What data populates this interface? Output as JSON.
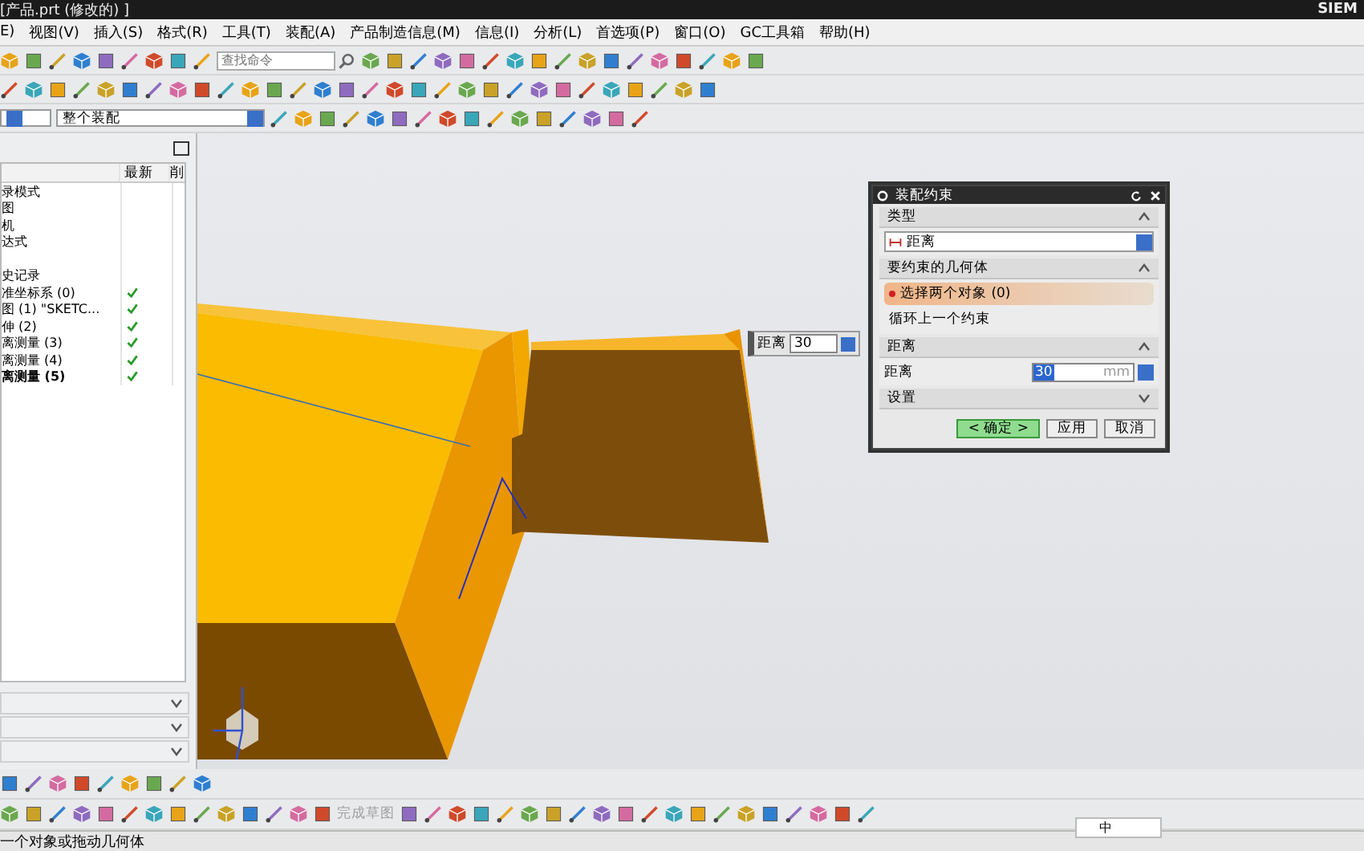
{
  "window": {
    "title": "[产品.prt (修改的) ]",
    "brand": "SIEM"
  },
  "menu": [
    "E)",
    "视图(V)",
    "插入(S)",
    "格式(R)",
    "工具(T)",
    "装配(A)",
    "产品制造信息(M)",
    "信息(I)",
    "分析(L)",
    "首选项(P)",
    "窗口(O)",
    "GC工具箱",
    "帮助(H)"
  ],
  "search": {
    "placeholder": "查找命令"
  },
  "filter": {
    "value": "整个装配"
  },
  "navigator": {
    "columns": [
      "最新",
      "削"
    ],
    "rows": [
      {
        "name": "录模式",
        "latest": false,
        "bold": false
      },
      {
        "name": "图",
        "latest": false,
        "bold": false
      },
      {
        "name": "机",
        "latest": false,
        "bold": false
      },
      {
        "name": "达式",
        "latest": false,
        "bold": false
      },
      {
        "latest": false
      },
      {
        "name": "史记录",
        "latest": false,
        "bold": false
      },
      {
        "name": "准坐标系 (0)",
        "latest": true,
        "bold": false
      },
      {
        "name": "图 (1) \"SKETC...",
        "latest": true,
        "bold": false
      },
      {
        "name": "伸 (2)",
        "latest": true,
        "bold": false
      },
      {
        "name": "离测量 (3)",
        "latest": true,
        "bold": false
      },
      {
        "name": "离测量 (4)",
        "latest": true,
        "bold": false
      },
      {
        "name": "离测量 (5)",
        "latest": true,
        "bold": true
      }
    ]
  },
  "panels": [
    {
      "expanded": false
    },
    {
      "expanded": false
    },
    {
      "expanded": false
    }
  ],
  "viewport": {
    "dimension_label": "距离",
    "dimension_value": "30"
  },
  "dialog": {
    "title": "装配约束",
    "sections": [
      {
        "kind": "type",
        "title": "类型",
        "expanded": true,
        "value": "距离"
      },
      {
        "kind": "geometry",
        "title": "要约束的几何体",
        "expanded": true,
        "items": [
          {
            "label": "选择两个对象 (0)",
            "selected": true
          },
          {
            "label": "循环上一个约束",
            "selected": false
          }
        ]
      },
      {
        "kind": "distance",
        "title": "距离",
        "expanded": true,
        "field_label": "距离",
        "value": "30",
        "unit": "mm"
      },
      {
        "kind": "settings",
        "title": "设置",
        "expanded": false
      }
    ],
    "buttons": [
      {
        "label": "< 确定 >",
        "default": true
      },
      {
        "label": "应用",
        "default": false
      },
      {
        "label": "取消",
        "default": false
      }
    ]
  },
  "sketch_tool": {
    "label": "完成草图",
    "disabled": true
  },
  "ime_bar": {
    "mode": "中"
  },
  "status_bar": "一个对象或拖动几何体"
}
